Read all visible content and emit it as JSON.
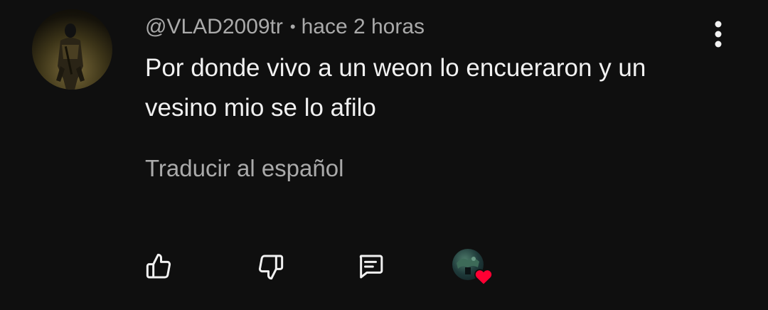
{
  "comment": {
    "author": "@VLAD2009tr",
    "separator": "•",
    "time": "hace 2 horas",
    "text": "Por donde vivo a un weon lo encueraron y un vesino mio se lo afilo",
    "translate_label": "Traducir al español"
  },
  "icons": {
    "more": "more-vertical-icon",
    "like": "thumbs-up-icon",
    "dislike": "thumbs-down-icon",
    "reply": "comment-icon",
    "creator_heart": "heart-icon"
  },
  "colors": {
    "background": "#0f0f0f",
    "primary_text": "#f1f1f1",
    "secondary_text": "#aaaaaa",
    "heart": "#ff0033"
  }
}
